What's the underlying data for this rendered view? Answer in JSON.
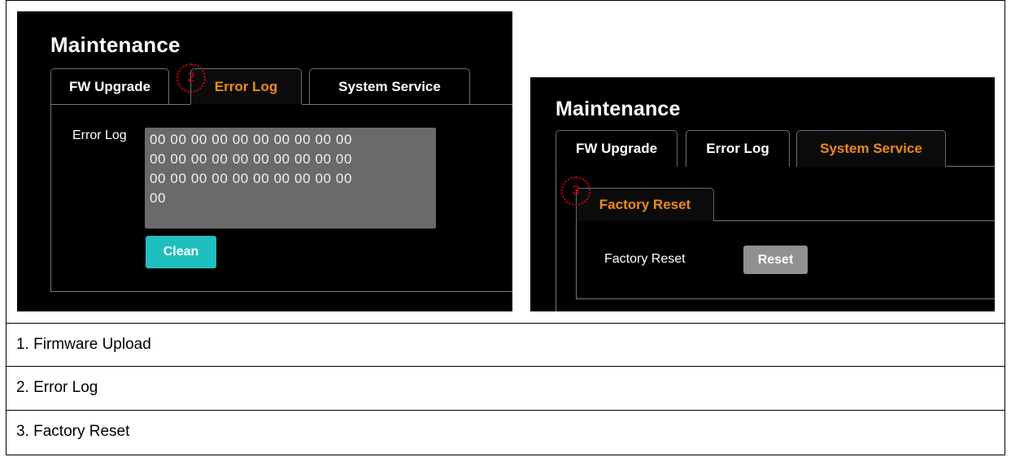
{
  "left_screenshot": {
    "title": "Maintenance",
    "tabs": [
      {
        "label": "FW Upgrade"
      },
      {
        "label": "Error Log"
      },
      {
        "label": "System Service"
      }
    ],
    "active_tab": "Error Log",
    "marker": "2",
    "error_log_label": "Error Log",
    "error_log_value": "00 00 00 00 00 00 00 00 00 00\n00 00 00 00 00 00 00 00 00 00\n00 00 00 00 00 00 00 00 00 00\n00",
    "clean_button": "Clean",
    "colors": {
      "active_tab": "#ee8a1a",
      "clean_button": "#1fbfbf"
    }
  },
  "right_screenshot": {
    "title": "Maintenance",
    "tabs": [
      {
        "label": "FW Upgrade"
      },
      {
        "label": "Error Log"
      },
      {
        "label": "System Service"
      }
    ],
    "active_tab": "System Service",
    "subtab": "Factory Reset",
    "marker": "3",
    "factory_reset_label": "Factory Reset",
    "reset_button": "Reset",
    "colors": {
      "active_tab": "#ee8a1a",
      "reset_button": "#909090"
    }
  },
  "captions": [
    "1. Firmware Upload",
    "2. Error Log",
    "3. Factory Reset"
  ],
  "marker_color": "#e00000"
}
